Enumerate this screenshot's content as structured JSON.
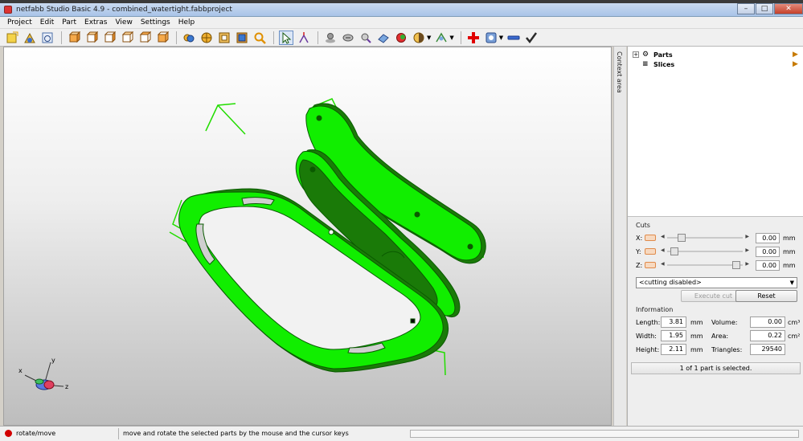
{
  "window": {
    "title": "netfabb Studio Basic 4.9 - combined_watertight.fabbproject",
    "minimize": "–",
    "maximize": "□",
    "close": "✕"
  },
  "menu": [
    "Project",
    "Edit",
    "Part",
    "Extras",
    "View",
    "Settings",
    "Help"
  ],
  "toolbar": {
    "icons": [
      "new-project-icon",
      "open-parts-icon",
      "save-icon",
      "view-front-icon",
      "view-back-icon",
      "view-left-icon",
      "view-right-icon",
      "view-top-icon",
      "view-bottom-icon",
      "shaded-mode-icon",
      "wireframe-mode-icon",
      "triangles-mode-icon",
      "normals-mode-icon",
      "zoom-icon",
      "select-arrow-icon",
      "rotate-move-icon",
      "measure-icon",
      "repair-icon",
      "analysis-icon",
      "slices-icon",
      "color-icon",
      "shading-icon",
      "support-icon",
      "add-part-icon",
      "export-icon",
      "remove-icon",
      "apply-check-icon"
    ],
    "accent_add": "#e00000",
    "accent_check": "#2a2a2a"
  },
  "viewport": {
    "model_color": "#11ee00",
    "axis_labels": {
      "x": "x",
      "y": "y",
      "z": "z"
    }
  },
  "side_tab": {
    "label": "Context area"
  },
  "tree": {
    "items": [
      {
        "label": "Parts",
        "expander": "+"
      },
      {
        "label": "Slices",
        "expander": ""
      }
    ]
  },
  "cuts": {
    "title": "Cuts",
    "rows": [
      {
        "axis": "X:",
        "value": "0.00",
        "unit": "mm",
        "position": 0.16
      },
      {
        "axis": "Y:",
        "value": "0.00",
        "unit": "mm",
        "position": 0.05
      },
      {
        "axis": "Z:",
        "value": "0.00",
        "unit": "mm",
        "position": 0.97
      }
    ],
    "mode": "<cutting disabled>",
    "execute_label": "Execute cut",
    "reset_label": "Reset"
  },
  "information": {
    "title": "Information",
    "length_label": "Length:",
    "length_value": "3.81",
    "length_unit": "mm",
    "width_label": "Width:",
    "width_value": "1.95",
    "width_unit": "mm",
    "height_label": "Height:",
    "height_value": "2.11",
    "height_unit": "mm",
    "volume_label": "Volume:",
    "volume_value": "0.00",
    "volume_unit": "cm³",
    "area_label": "Area:",
    "area_value": "0.22",
    "area_unit": "cm²",
    "triangles_label": "Triangles:",
    "triangles_value": "29540"
  },
  "selection_status": "1 of 1 part is selected.",
  "statusbar": {
    "mode": "rotate/move",
    "hint": "move and rotate the selected parts by the mouse and the cursor keys"
  }
}
